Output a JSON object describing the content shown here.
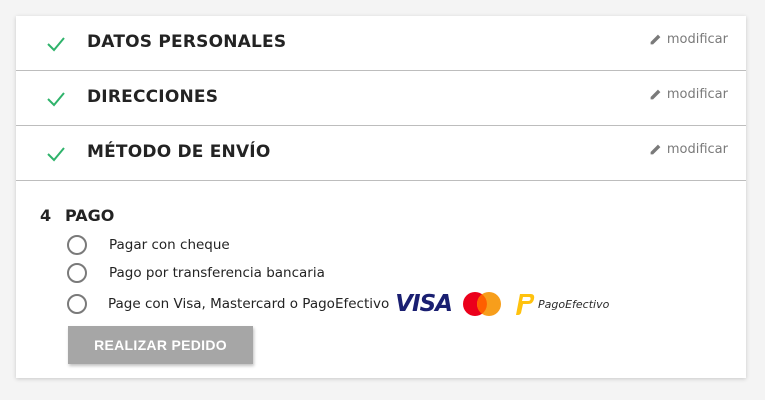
{
  "steps": [
    {
      "title": "DATOS PERSONALES",
      "edit": "modificar"
    },
    {
      "title": "DIRECCIONES",
      "edit": "modificar"
    },
    {
      "title": "MÉTODO DE ENVÍO",
      "edit": "modificar"
    }
  ],
  "payment": {
    "number": "4",
    "title": "PAGO",
    "options": [
      {
        "label": "Pagar con cheque"
      },
      {
        "label": "Pago por transferencia bancaria"
      },
      {
        "label": "Page con Visa, Mastercard o PagoEfectivo"
      }
    ],
    "logos": {
      "visa": "VISA",
      "pagoefectivo": "PagoEfectivo"
    },
    "submit_label": "REALIZAR PEDIDO"
  },
  "colors": {
    "check": "#2fb36b",
    "button": "#a6a6a6",
    "visa": "#1a1f71"
  }
}
